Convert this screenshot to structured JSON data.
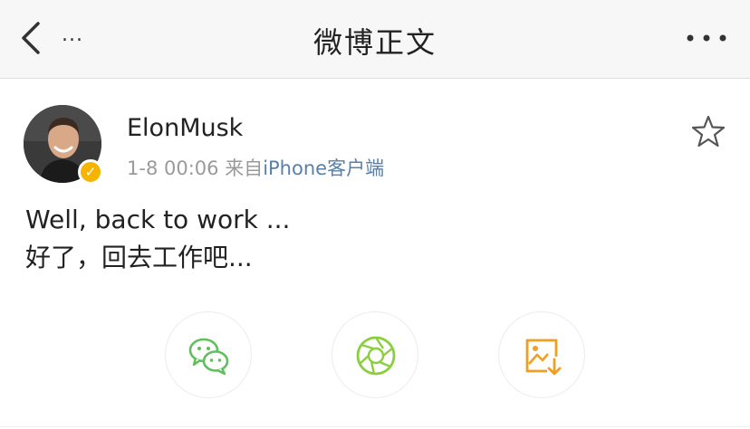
{
  "nav": {
    "more_left": "...",
    "title": "微博正文"
  },
  "post": {
    "author": "ElonMusk",
    "time": "1-8 00:06",
    "source_prefix": "来自",
    "source": "iPhone客户端",
    "lines": [
      "Well, back to work ...",
      "好了，回去工作吧..."
    ]
  },
  "share": {
    "icons": [
      "wechat-icon",
      "wechat-moments-icon",
      "save-image-icon"
    ]
  },
  "colors": {
    "verify_badge": "#f6b400",
    "source_link": "#5a7fa8",
    "wechat_green": "#5fbf5b",
    "moments_green": "#8ccf3e",
    "save_orange": "#f0a020"
  }
}
